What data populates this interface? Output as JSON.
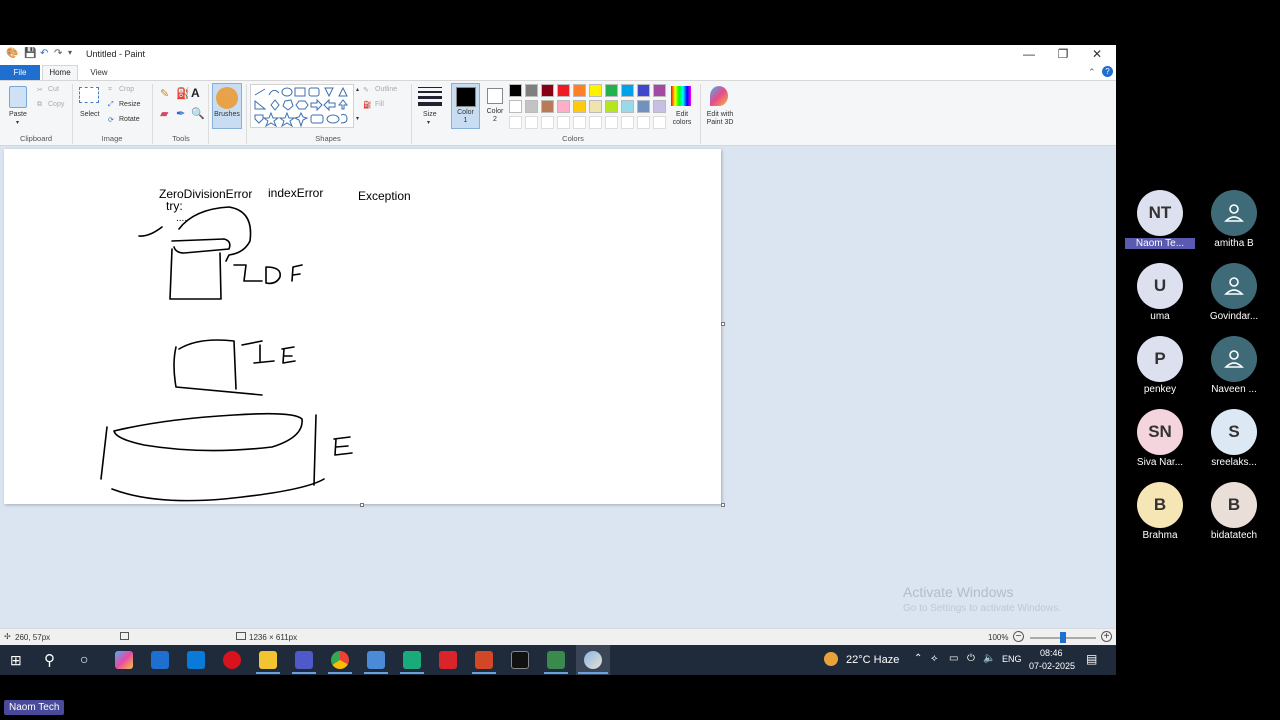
{
  "window": {
    "title": "Untitled - Paint",
    "minimize": "—",
    "restore": "❐",
    "close": "✕"
  },
  "tabs": {
    "file": "File",
    "home": "Home",
    "view": "View"
  },
  "ribbon": {
    "clipboard": {
      "label": "Clipboard",
      "paste": "Paste",
      "cut": "Cut",
      "copy": "Copy"
    },
    "image": {
      "label": "Image",
      "select": "Select",
      "crop": "Crop",
      "resize": "Resize",
      "rotate": "Rotate"
    },
    "tools": {
      "label": "Tools"
    },
    "brushes": {
      "label": "Brushes"
    },
    "shapes": {
      "label": "Shapes",
      "outline": "Outline",
      "fill": "Fill"
    },
    "size": {
      "label": "Size"
    },
    "color1": {
      "label": "Color 1"
    },
    "color2": {
      "label": "Color 2"
    },
    "colors": {
      "label": "Colors"
    },
    "edit_colors": "Edit colors",
    "edit_paint3d": "Edit with Paint 3D",
    "palette": [
      "#000000",
      "#7f7f7f",
      "#880015",
      "#ed1c24",
      "#ff7f27",
      "#fff200",
      "#22b14c",
      "#00a2e8",
      "#3f48cc",
      "#a349a4",
      "#ffffff",
      "#c3c3c3",
      "#b97a57",
      "#ffaec9",
      "#ffc90e",
      "#efe4b0",
      "#b5e61d",
      "#99d9ea",
      "#7092be",
      "#c8bfe7"
    ]
  },
  "canvas": {
    "text_zero": "ZeroDivisionError",
    "text_try": "try:",
    "text_dots": "....",
    "text_index": "indexError",
    "text_exception": "Exception"
  },
  "status": {
    "cursor_pos": "260, 57px",
    "canvas_size": "1236 × 611px",
    "zoom": "100%"
  },
  "watermark": {
    "line1": "Activate Windows",
    "line2": "Go to Settings to activate Windows."
  },
  "participants": [
    {
      "initials": "NT",
      "name": "Naom Te...",
      "color": "#dde0ee",
      "highlight": true
    },
    {
      "initials": "",
      "name": "amitha B",
      "color": "#3f6b78",
      "icon": true
    },
    {
      "initials": "U",
      "name": "uma",
      "color": "#dde0ee"
    },
    {
      "initials": "",
      "name": "Govindar...",
      "color": "#3f6b78",
      "icon": true
    },
    {
      "initials": "P",
      "name": "penkey",
      "color": "#dde0ee"
    },
    {
      "initials": "",
      "name": "Naveen ...",
      "color": "#3f6b78",
      "icon": true
    },
    {
      "initials": "SN",
      "name": "Siva Nar...",
      "color": "#f5d5dd"
    },
    {
      "initials": "S",
      "name": "sreelaks...",
      "color": "#dde8f5"
    },
    {
      "initials": "B",
      "name": "Brahma",
      "color": "#f7e6b5"
    },
    {
      "initials": "B",
      "name": "bidatatech",
      "color": "#eadfd8"
    }
  ],
  "taskbar": {
    "weather": "22°C  Haze",
    "lang": "ENG",
    "time": "08:46",
    "date": "07-02-2025"
  },
  "presenter_tag": "Naom Tech"
}
